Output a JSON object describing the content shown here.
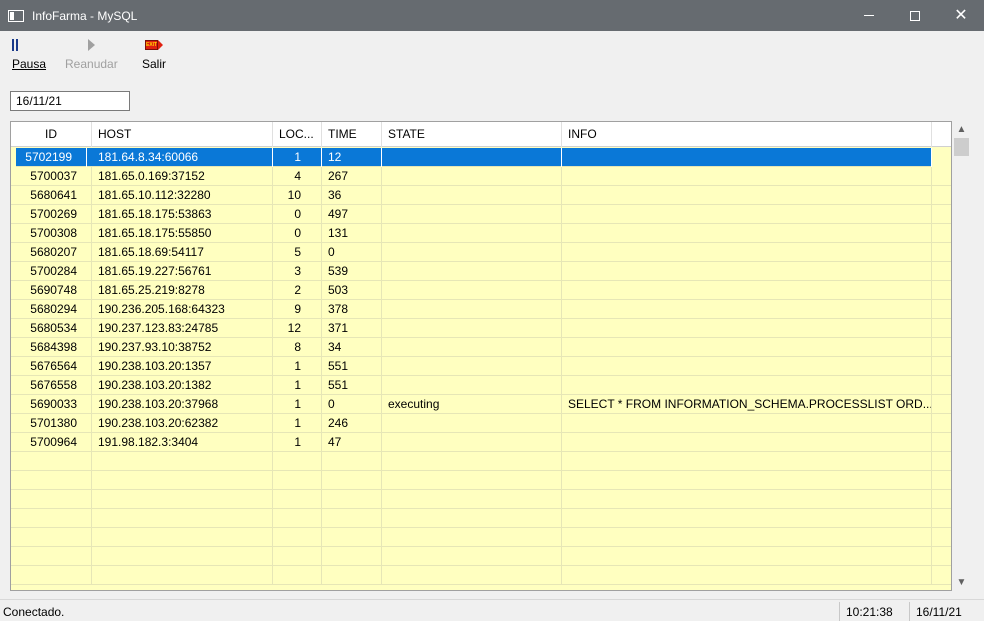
{
  "window": {
    "title": "InfoFarma - MySQL",
    "minimize_icon": "minimize-icon",
    "maximize_icon": "maximize-icon",
    "close_icon": "close-icon"
  },
  "toolbar": {
    "pause_label": "Pausa",
    "resume_label": "Reanudar",
    "exit_label": "Salir",
    "exit_icon_text": "EXIT"
  },
  "date_field": {
    "value": "16/11/21"
  },
  "grid": {
    "columns": [
      "ID",
      "HOST",
      "LOC...",
      "TIME",
      "STATE",
      "INFO"
    ],
    "rows": [
      {
        "id": "5702199",
        "host": "181.64.8.34:60066",
        "loc": "1",
        "time": "12",
        "state": "",
        "info": ""
      },
      {
        "id": "5700037",
        "host": "181.65.0.169:37152",
        "loc": "4",
        "time": "267",
        "state": "",
        "info": ""
      },
      {
        "id": "5680641",
        "host": "181.65.10.112:32280",
        "loc": "10",
        "time": "36",
        "state": "",
        "info": ""
      },
      {
        "id": "5700269",
        "host": "181.65.18.175:53863",
        "loc": "0",
        "time": "497",
        "state": "",
        "info": ""
      },
      {
        "id": "5700308",
        "host": "181.65.18.175:55850",
        "loc": "0",
        "time": "131",
        "state": "",
        "info": ""
      },
      {
        "id": "5680207",
        "host": "181.65.18.69:54117",
        "loc": "5",
        "time": "0",
        "state": "",
        "info": ""
      },
      {
        "id": "5700284",
        "host": "181.65.19.227:56761",
        "loc": "3",
        "time": "539",
        "state": "",
        "info": ""
      },
      {
        "id": "5690748",
        "host": "181.65.25.219:8278",
        "loc": "2",
        "time": "503",
        "state": "",
        "info": ""
      },
      {
        "id": "5680294",
        "host": "190.236.205.168:64323",
        "loc": "9",
        "time": "378",
        "state": "",
        "info": ""
      },
      {
        "id": "5680534",
        "host": "190.237.123.83:24785",
        "loc": "12",
        "time": "371",
        "state": "",
        "info": ""
      },
      {
        "id": "5684398",
        "host": "190.237.93.10:38752",
        "loc": "8",
        "time": "34",
        "state": "",
        "info": ""
      },
      {
        "id": "5676564",
        "host": "190.238.103.20:1357",
        "loc": "1",
        "time": "551",
        "state": "",
        "info": ""
      },
      {
        "id": "5676558",
        "host": "190.238.103.20:1382",
        "loc": "1",
        "time": "551",
        "state": "",
        "info": ""
      },
      {
        "id": "5690033",
        "host": "190.238.103.20:37968",
        "loc": "1",
        "time": "0",
        "state": "executing",
        "info": "SELECT * FROM INFORMATION_SCHEMA.PROCESSLIST ORD..."
      },
      {
        "id": "5701380",
        "host": "190.238.103.20:62382",
        "loc": "1",
        "time": "246",
        "state": "",
        "info": ""
      },
      {
        "id": "5700964",
        "host": "191.98.182.3:3404",
        "loc": "1",
        "time": "47",
        "state": "",
        "info": ""
      }
    ],
    "selected_row_index": 0
  },
  "status": {
    "message": "Conectado.",
    "time": "10:21:38",
    "date": "16/11/21"
  },
  "colors": {
    "titlebar": "#666b70",
    "grid_background": "#ffffc0",
    "selection": "#0a78d7"
  }
}
